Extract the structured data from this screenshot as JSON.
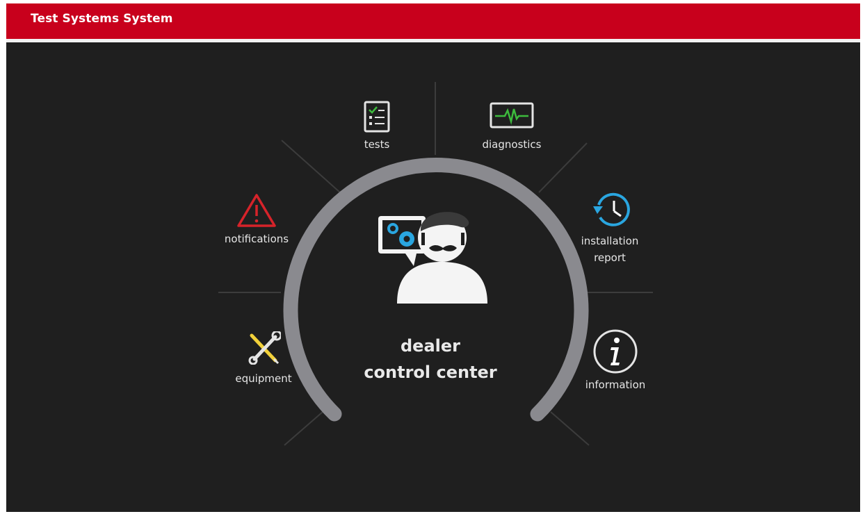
{
  "app": {
    "title": "Test Systems System"
  },
  "center": {
    "line1": "dealer",
    "line2": "control center"
  },
  "menu": {
    "tests": "tests",
    "diagnostics": "diagnostics",
    "notifications": "notifications",
    "installation_line1": "installation",
    "installation_line2": "report",
    "equipment": "equipment",
    "information": "information"
  },
  "icons": {
    "tests": "checklist-icon",
    "diagnostics": "heartbeat-monitor-icon",
    "notifications": "warning-triangle-icon",
    "installation": "history-clock-icon",
    "equipment": "wrench-screwdriver-icon",
    "information": "info-circle-icon",
    "center": "dealer-avatar-icon"
  },
  "colors": {
    "header": "#c8001c",
    "background": "#1f1f1f",
    "arc": "#8a8a8f",
    "accent_blue": "#2aa6e0",
    "warning_red": "#d6232a",
    "monitor_green": "#3dbb3d",
    "tool_yellow": "#f2d13a"
  }
}
